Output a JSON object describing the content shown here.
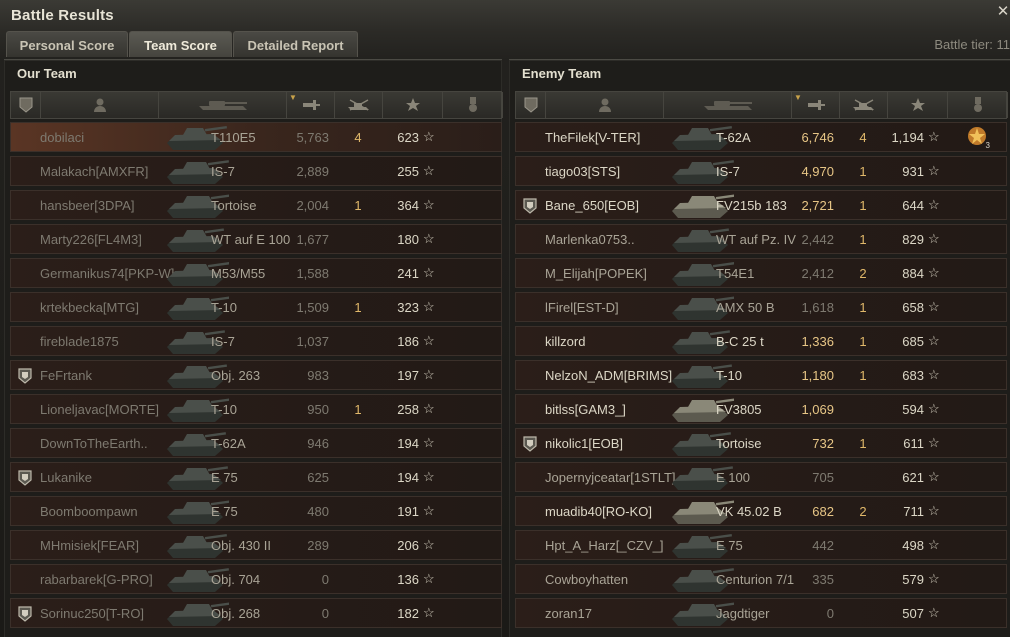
{
  "window": {
    "title": "Battle Results",
    "close_icon": "close-icon",
    "battle_tier": "Battle tier: 11"
  },
  "tabs": [
    {
      "label": "Personal Score",
      "active": false
    },
    {
      "label": "Team Score",
      "active": true
    },
    {
      "label": "Detailed Report",
      "active": false
    }
  ],
  "columns": [
    {
      "icon": "squad-icon"
    },
    {
      "icon": "player-icon"
    },
    {
      "icon": "tank-icon"
    },
    {
      "icon": "damage-icon",
      "sorted": true
    },
    {
      "icon": "frags-icon"
    },
    {
      "icon": "xp-star-icon"
    },
    {
      "icon": "medal-icon"
    }
  ],
  "our_team": {
    "title": "Our Team",
    "players": [
      {
        "name": "dobilaci",
        "vehicle": "T110E5",
        "damage": "5,763",
        "frags": "4",
        "xp": "623",
        "squad": false,
        "highlight": true,
        "tone": "dim"
      },
      {
        "name": "Malakach[AMXFR]",
        "vehicle": "IS-7",
        "damage": "2,889",
        "frags": "",
        "xp": "255",
        "squad": false,
        "tone": "dim"
      },
      {
        "name": "hansbeer[3DPA]",
        "vehicle": "Tortoise",
        "damage": "2,004",
        "frags": "1",
        "xp": "364",
        "squad": false,
        "tone": "dim"
      },
      {
        "name": "Marty226[FL4M3]",
        "vehicle": "WT auf E 100",
        "damage": "1,677",
        "frags": "",
        "xp": "180",
        "squad": false,
        "tone": "dim"
      },
      {
        "name": "Germanikus74[PKP-W]",
        "vehicle": "M53/M55",
        "damage": "1,588",
        "frags": "",
        "xp": "241",
        "squad": false,
        "tone": "dim"
      },
      {
        "name": "krtekbecka[MTG]",
        "vehicle": "T-10",
        "damage": "1,509",
        "frags": "1",
        "xp": "323",
        "squad": false,
        "tone": "dim"
      },
      {
        "name": "fireblade1875",
        "vehicle": "IS-7",
        "damage": "1,037",
        "frags": "",
        "xp": "186",
        "squad": false,
        "tone": "dim"
      },
      {
        "name": "FeFrtank",
        "vehicle": "Obj. 263",
        "damage": "983",
        "frags": "",
        "xp": "197",
        "squad": true,
        "tone": "dim"
      },
      {
        "name": "Lioneljavac[MORTE]",
        "vehicle": "T-10",
        "damage": "950",
        "frags": "1",
        "xp": "258",
        "squad": false,
        "tone": "dim"
      },
      {
        "name": "DownToTheEarth..",
        "vehicle": "T-62A",
        "damage": "946",
        "frags": "",
        "xp": "194",
        "squad": false,
        "tone": "dim"
      },
      {
        "name": "Lukanike",
        "vehicle": "E 75",
        "damage": "625",
        "frags": "",
        "xp": "194",
        "squad": true,
        "tone": "dim"
      },
      {
        "name": "Boomboompawn",
        "vehicle": "E 75",
        "damage": "480",
        "frags": "",
        "xp": "191",
        "squad": false,
        "tone": "dim"
      },
      {
        "name": "MHmisiek[FEAR]",
        "vehicle": "Obj. 430 II",
        "damage": "289",
        "frags": "",
        "xp": "206",
        "squad": false,
        "tone": "dim"
      },
      {
        "name": "rabarbarek[G-PRO]",
        "vehicle": "Obj. 704",
        "damage": "0",
        "frags": "",
        "xp": "136",
        "squad": false,
        "tone": "dim"
      },
      {
        "name": "Sorinuc250[T-RO]",
        "vehicle": "Obj. 268",
        "damage": "0",
        "frags": "",
        "xp": "182",
        "squad": true,
        "tone": "dim"
      }
    ]
  },
  "enemy_team": {
    "title": "Enemy Team",
    "players": [
      {
        "name": "TheFilek[V-TER]",
        "vehicle": "T-62A",
        "damage": "6,746",
        "frags": "4",
        "xp": "1,194",
        "squad": false,
        "tone": "bright",
        "medal": {
          "icon": "ace-medal-icon",
          "count": "3"
        }
      },
      {
        "name": "tiago03[STS]",
        "vehicle": "IS-7",
        "damage": "4,970",
        "frags": "1",
        "xp": "931",
        "squad": false,
        "tone": "bright"
      },
      {
        "name": "Bane_650[EOB]",
        "vehicle": "FV215b 183",
        "damage": "2,721",
        "frags": "1",
        "xp": "644",
        "squad": true,
        "tone": "bright"
      },
      {
        "name": "Marlenka0753..",
        "vehicle": "WT auf Pz. IV",
        "damage": "2,442",
        "frags": "1",
        "xp": "829",
        "squad": false,
        "tone": "mid"
      },
      {
        "name": "M_Elijah[POPEK]",
        "vehicle": "T54E1",
        "damage": "2,412",
        "frags": "2",
        "xp": "884",
        "squad": false,
        "tone": "mid"
      },
      {
        "name": "lFirel[EST-D]",
        "vehicle": "AMX 50 B",
        "damage": "1,618",
        "frags": "1",
        "xp": "658",
        "squad": false,
        "tone": "mid"
      },
      {
        "name": "killzord",
        "vehicle": "B-C 25 t",
        "damage": "1,336",
        "frags": "1",
        "xp": "685",
        "squad": false,
        "tone": "bright"
      },
      {
        "name": "NelzoN_ADM[BRIMS]",
        "vehicle": "T-10",
        "damage": "1,180",
        "frags": "1",
        "xp": "683",
        "squad": false,
        "tone": "bright"
      },
      {
        "name": "bitlss[GAM3_]",
        "vehicle": "FV3805",
        "damage": "1,069",
        "frags": "",
        "xp": "594",
        "squad": false,
        "tone": "bright"
      },
      {
        "name": "nikolic1[EOB]",
        "vehicle": "Tortoise",
        "damage": "732",
        "frags": "1",
        "xp": "611",
        "squad": true,
        "tone": "bright"
      },
      {
        "name": "Jopernyjceatar[1STLT]",
        "vehicle": "E 100",
        "damage": "705",
        "frags": "",
        "xp": "621",
        "squad": false,
        "tone": "mid"
      },
      {
        "name": "muadib40[RO-KO]",
        "vehicle": "VK 45.02 B",
        "damage": "682",
        "frags": "2",
        "xp": "711",
        "squad": false,
        "tone": "bright"
      },
      {
        "name": "Hpt_A_Harz[_CZV_]",
        "vehicle": "E 75",
        "damage": "442",
        "frags": "",
        "xp": "498",
        "squad": false,
        "tone": "mid"
      },
      {
        "name": "Cowboyhatten",
        "vehicle": "Centurion 7/1",
        "damage": "335",
        "frags": "",
        "xp": "579",
        "squad": false,
        "tone": "mid"
      },
      {
        "name": "zoran17",
        "vehicle": "Jagdtiger",
        "damage": "0",
        "frags": "",
        "xp": "507",
        "squad": false,
        "tone": "mid"
      }
    ]
  },
  "colors": {
    "accent_gold": "#e0b86a",
    "row_bg": "#251b17",
    "highlight_row": "#5a3524"
  }
}
